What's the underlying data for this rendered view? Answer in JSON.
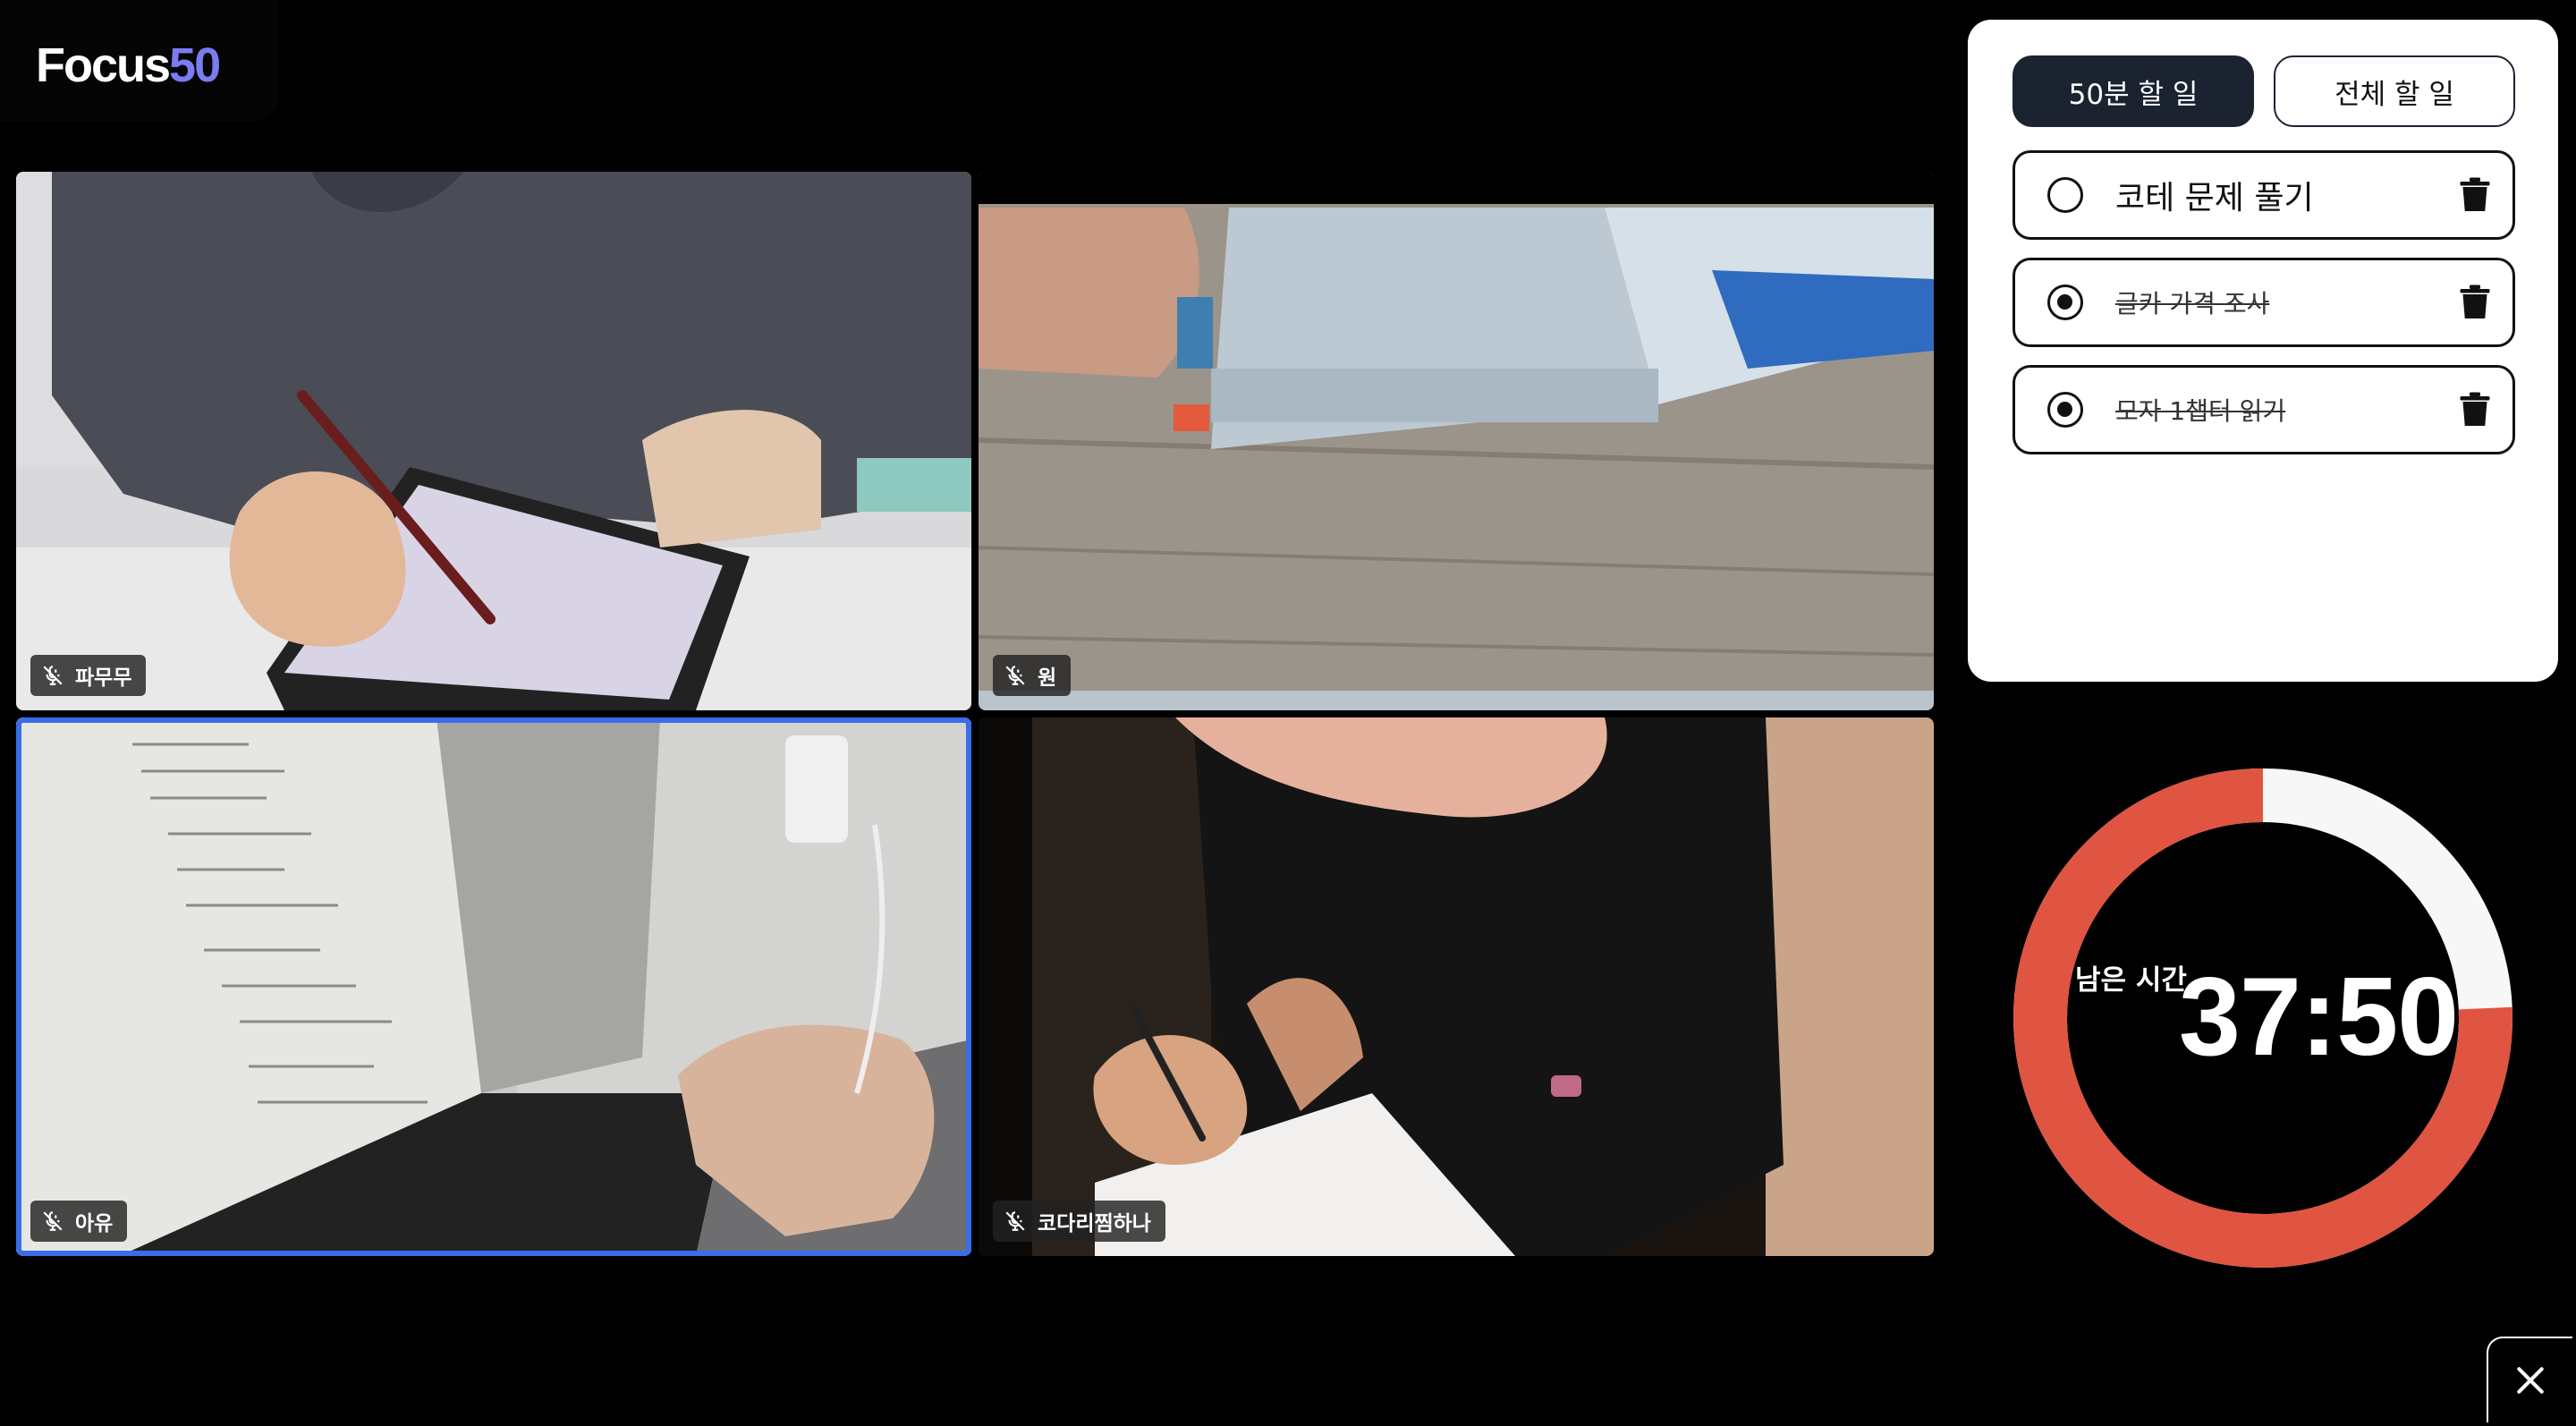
{
  "app": {
    "logo_main": "Focus",
    "logo_accent": "50",
    "accent_color": "#7b7cf2"
  },
  "participants": [
    {
      "name": "파무무",
      "mic": "muted",
      "scene": "writing on tablet"
    },
    {
      "name": "원",
      "mic": "muted",
      "scene": "open book on desk"
    },
    {
      "name": "아유",
      "mic": "muted",
      "scene": "typing on laptop",
      "active_speaker": true
    },
    {
      "name": "코다리찜하나",
      "mic": "muted",
      "scene": "writing at desk"
    }
  ],
  "todo": {
    "tabs": [
      {
        "label": "50분 할 일",
        "active": true
      },
      {
        "label": "전체 할 일",
        "active": false
      }
    ],
    "items": [
      {
        "text": "코테 문제 풀기",
        "done": false
      },
      {
        "text": "글카 가격 조사",
        "done": true
      },
      {
        "text": "모자 1챕터 읽기",
        "done": true
      }
    ]
  },
  "timer": {
    "label": "남은 시간",
    "value": "37:50",
    "remaining_fraction": 0.757,
    "ring_color": "#e05442",
    "track_color": "#f7f7f7"
  },
  "icons": {
    "mic": "mic-off-icon",
    "delete": "trash-icon",
    "close": "close-icon"
  }
}
